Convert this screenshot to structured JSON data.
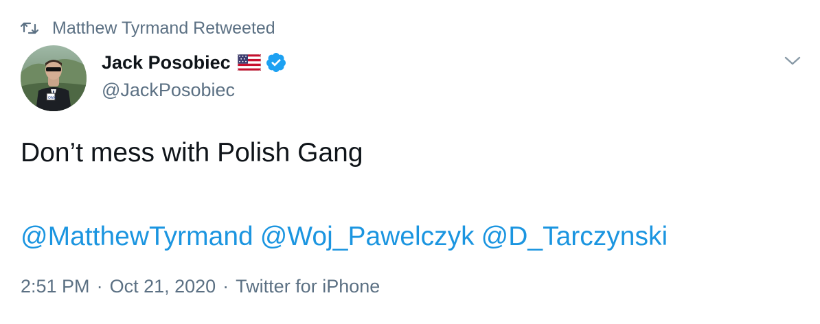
{
  "retweet": {
    "icon": "retweet-icon",
    "label": "Matthew Tyrmand Retweeted"
  },
  "author": {
    "display_name": "Jack Posobiec",
    "handle": "@JackPosobiec",
    "flag_icon": "us-flag-icon",
    "verified_icon": "verified-badge-icon",
    "avatar_icon": "avatar-photo"
  },
  "menu": {
    "icon": "chevron-down-icon"
  },
  "tweet": {
    "text": "Don’t mess with Polish Gang",
    "mentions": [
      "@MatthewTyrmand",
      "@Woj_Pawelczyk",
      "@D_Tarczynski"
    ]
  },
  "meta": {
    "time": "2:51 PM",
    "separator": "·",
    "date": "Oct 21, 2020",
    "source": "Twitter for iPhone"
  },
  "colors": {
    "link": "#1b95e0",
    "secondary": "#5b7083",
    "verified": "#1da1f2",
    "text": "#0f1419"
  }
}
